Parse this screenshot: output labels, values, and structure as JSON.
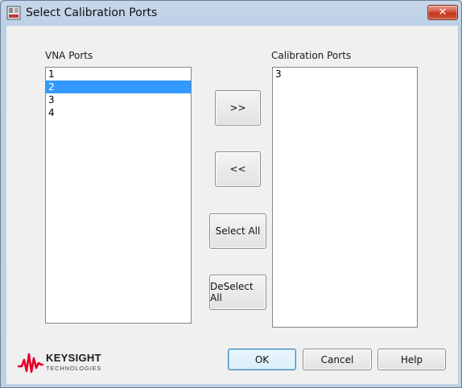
{
  "window": {
    "title": "Select Calibration Ports",
    "close_label": "✕"
  },
  "vna_ports": {
    "label": "VNA Ports",
    "items": [
      "1",
      "2",
      "3",
      "4"
    ],
    "selected": "2"
  },
  "calibration_ports": {
    "label": "Calibration Ports",
    "items": [
      "3"
    ]
  },
  "buttons": {
    "add": ">>",
    "remove": "<<",
    "select_all": "Select All",
    "deselect_all": "DeSelect All",
    "ok": "OK",
    "cancel": "Cancel",
    "help": "Help"
  },
  "logo": {
    "name": "KEYSIGHT",
    "sub": "TECHNOLOGIES",
    "color": "#e4002b"
  }
}
